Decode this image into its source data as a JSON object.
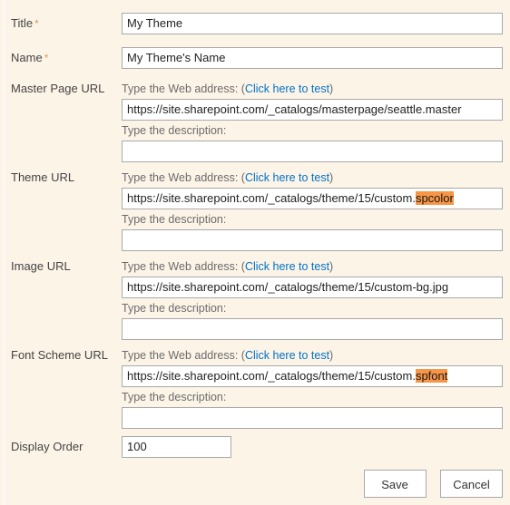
{
  "theme": {
    "background": "#fdf4e8",
    "accent_link": "#0072c6",
    "highlight": "#f79646",
    "required_mark": "#d9a05b",
    "field_border": "#a9a9a9"
  },
  "common": {
    "web_address_prefix": "Type the Web address: (",
    "test_link": "Click here to test",
    "web_address_suffix": ")",
    "description_label": "Type the description:",
    "required_symbol": "*"
  },
  "fields": {
    "title": {
      "label": "Title",
      "required": true,
      "value": "My Theme"
    },
    "name": {
      "label": "Name",
      "required": true,
      "value": "My Theme's Name"
    },
    "master_page_url": {
      "label": "Master Page URL",
      "url_value": "https://site.sharepoint.com/_catalogs/masterpage/seattle.master",
      "url_plain": "https://site.sharepoint.com/_catalogs/masterpage/seattle.master",
      "url_highlight": "",
      "description_value": ""
    },
    "theme_url": {
      "label": "Theme URL",
      "url_value": "https://site.sharepoint.com/_catalogs/theme/15/custom.spcolor",
      "url_plain": "https://site.sharepoint.com/_catalogs/theme/15/custom.",
      "url_highlight": "spcolor",
      "description_value": ""
    },
    "image_url": {
      "label": "Image URL",
      "url_value": "https://site.sharepoint.com/_catalogs/theme/15/custom-bg.jpg",
      "url_plain": "https://site.sharepoint.com/_catalogs/theme/15/custom-bg.jpg",
      "url_highlight": "",
      "description_value": ""
    },
    "font_scheme_url": {
      "label": "Font Scheme URL",
      "url_value": "https://site.sharepoint.com/_catalogs/theme/15/custom.spfont",
      "url_plain": "https://site.sharepoint.com/_catalogs/theme/15/custom.",
      "url_highlight": "spfont",
      "description_value": ""
    },
    "display_order": {
      "label": "Display Order",
      "value": "100"
    }
  },
  "buttons": {
    "save": "Save",
    "cancel": "Cancel"
  }
}
